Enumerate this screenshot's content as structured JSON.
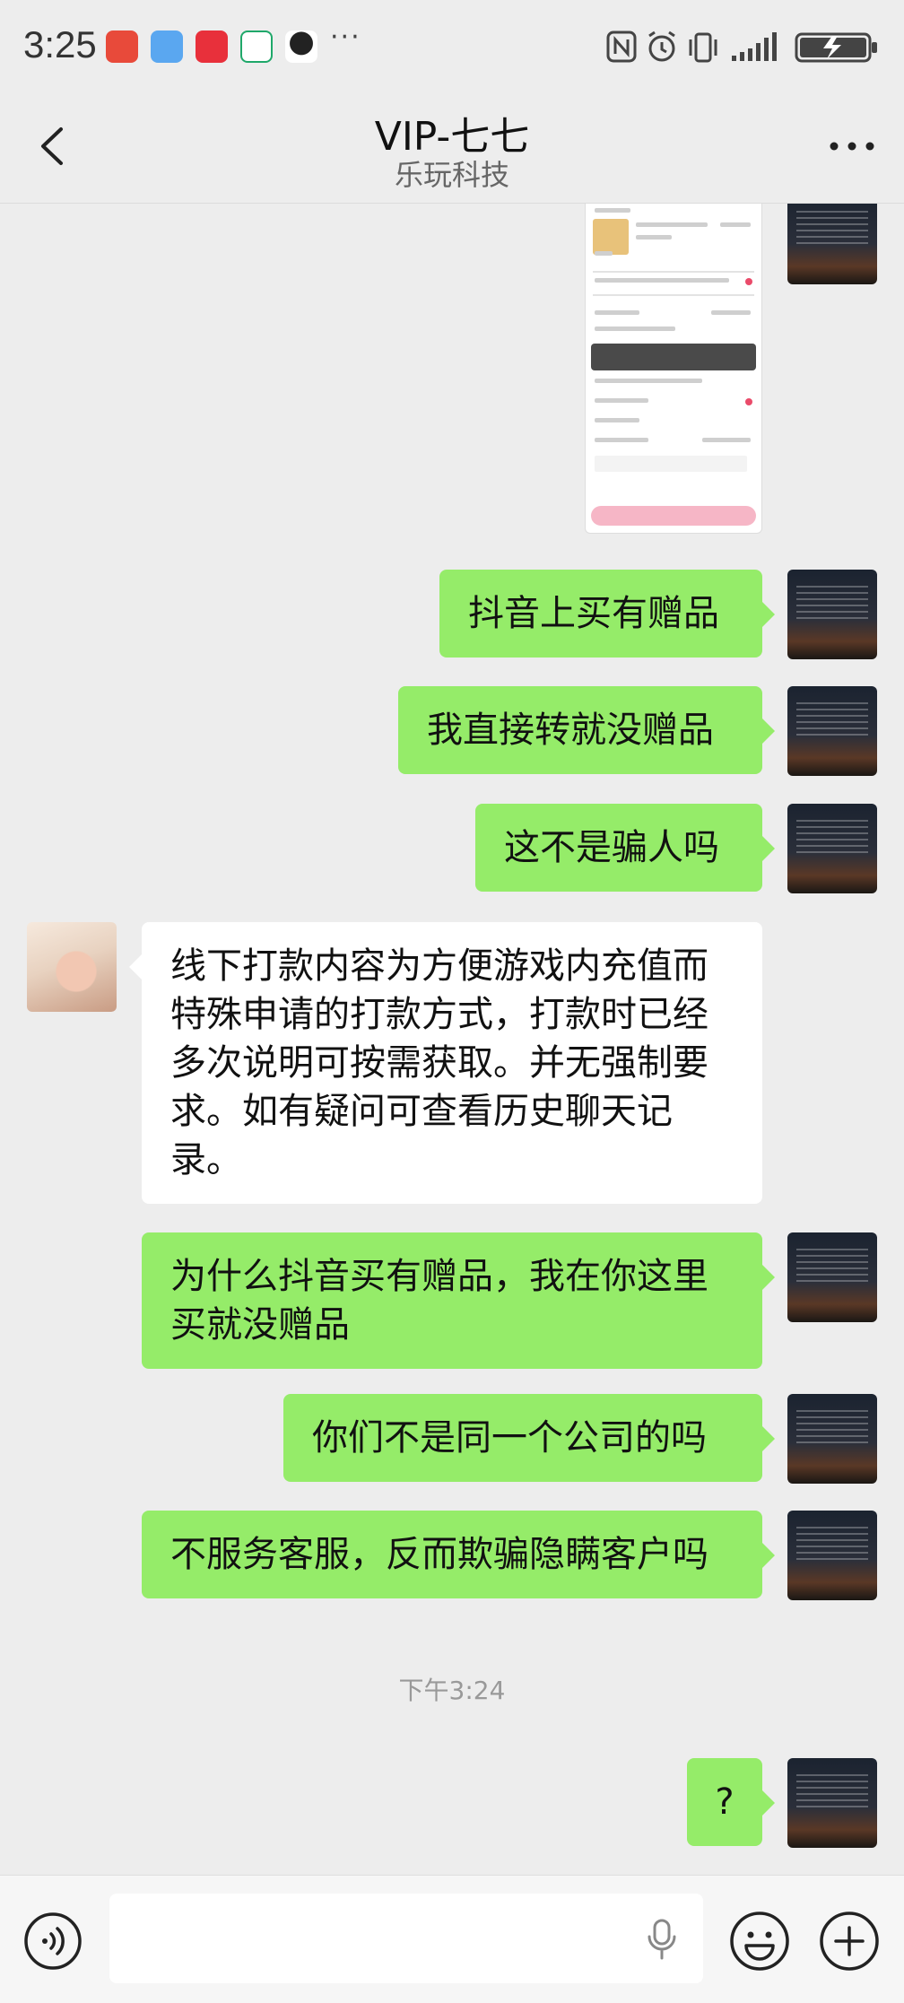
{
  "status_bar": {
    "time": "3:25",
    "more_indicator": "···",
    "icons": [
      "missed-call-icon",
      "app-6-icon",
      "huawei-app-icon",
      "home-app-icon",
      "qq-icon",
      "nfc-icon",
      "alarm-icon",
      "vibrate-icon",
      "signal-icon",
      "battery-icon"
    ]
  },
  "header": {
    "title": "VIP-七七",
    "subtitle": "乐玩科技"
  },
  "messages": [
    {
      "from": "me",
      "type": "image"
    },
    {
      "from": "me",
      "text": "抖音上买有赠品"
    },
    {
      "from": "me",
      "text": "我直接转就没赠品"
    },
    {
      "from": "me",
      "text": "这不是骗人吗"
    },
    {
      "from": "other",
      "line1": "线下打款内容为方便游戏内充值而",
      "line2": "特殊申请的打款方式，打款时已经",
      "line3": "多次说明可按需获取。并无强制要",
      "line4": "求。如有疑问可查看历史聊天记",
      "line5": "录。"
    },
    {
      "from": "me",
      "line1": "为什么抖音买有赠品，我在你这里",
      "line2": "买就没赠品"
    },
    {
      "from": "me",
      "text": "你们不是同一个公司的吗"
    },
    {
      "from": "me",
      "text": "不服务客服，反而欺骗隐瞒客户吗"
    },
    {
      "from": "me",
      "text": "?"
    }
  ],
  "timestamp": "下午3:24",
  "colors": {
    "my_bubble": "#95ec69",
    "other_bubble": "#ffffff",
    "background": "#ededed"
  }
}
